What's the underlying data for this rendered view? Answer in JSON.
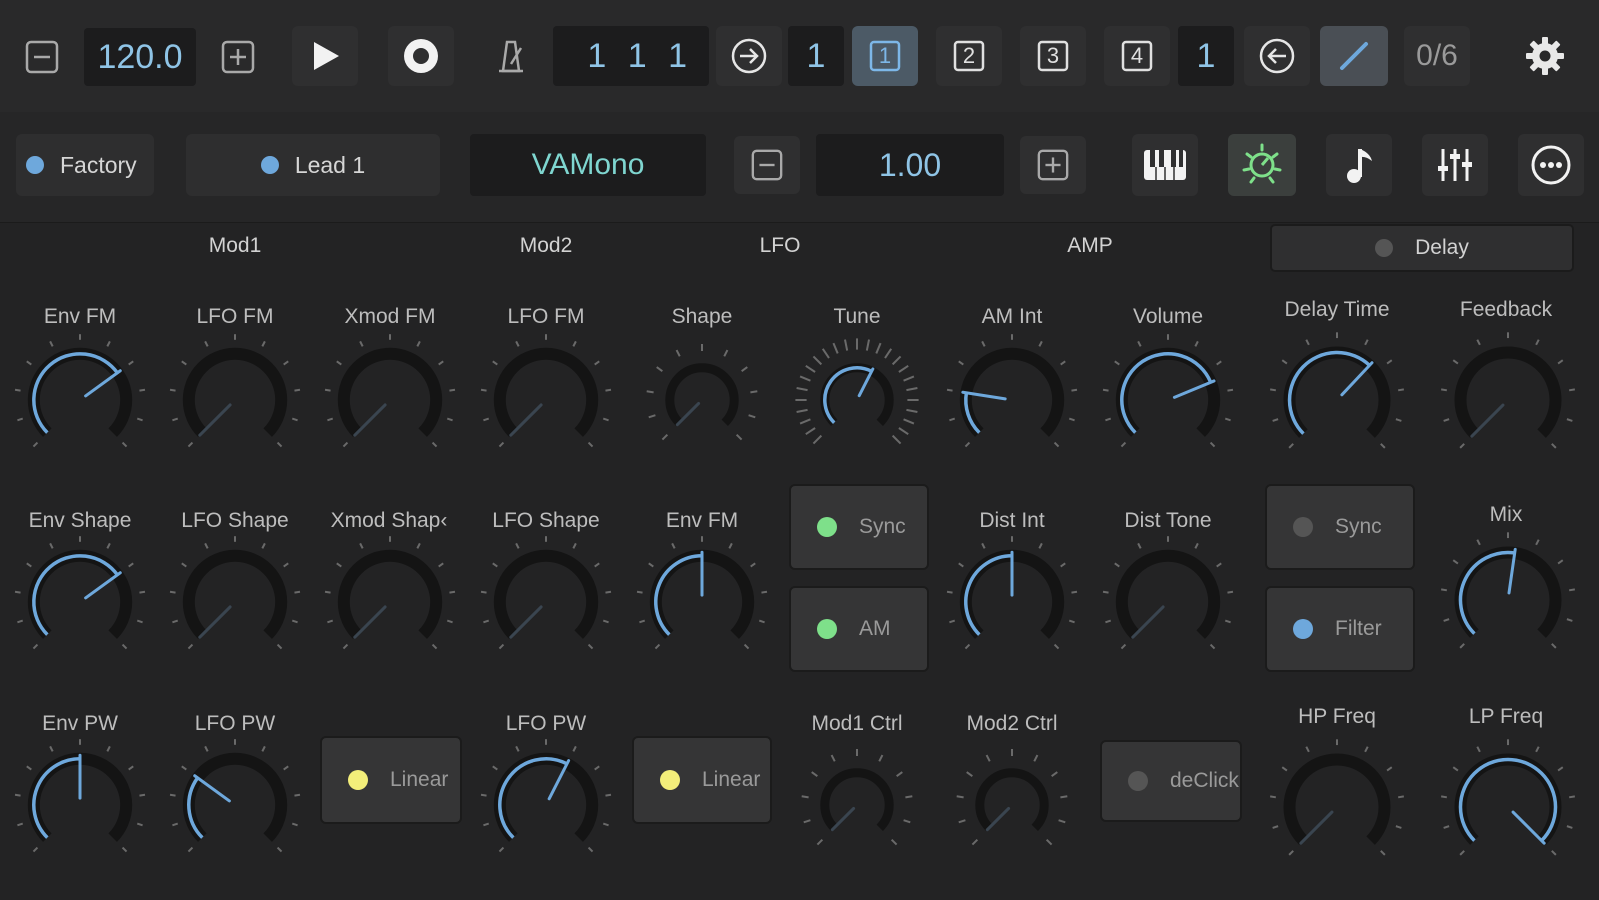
{
  "colors": {
    "accent_blue": "#6ea8dc",
    "green": "#7ee08a",
    "yellow": "#f3ee7a",
    "off": "#555555",
    "teal": "#7fd6d0"
  },
  "transport": {
    "tempo": "120.0",
    "position": "1 1 1",
    "loop_start": "1",
    "loop_end": "1",
    "scenes": [
      "1",
      "2",
      "3",
      "4"
    ],
    "counter": "0/6"
  },
  "instrument": {
    "bank_label": "Factory",
    "preset_label": "Lead 1",
    "synth_name": "VAMono",
    "param_value": "1.00"
  },
  "sections": {
    "mod1": "Mod1",
    "mod2": "Mod2",
    "lfo": "LFO",
    "amp": "AMP",
    "delay": "Delay"
  },
  "labels": {
    "env_fm_1": "Env FM",
    "lfo_fm_1": "LFO FM",
    "xmod_fm": "Xmod FM",
    "lfo_fm_2": "LFO FM",
    "shape": "Shape",
    "tune": "Tune",
    "am_int": "AM Int",
    "volume": "Volume",
    "delay_time": "Delay Time",
    "feedback": "Feedback",
    "env_shape": "Env Shape",
    "lfo_shape_1": "LFO Shape",
    "xmod_shape": "Xmod Shap‹",
    "lfo_shape_2": "LFO Shape",
    "env_fm_2": "Env FM",
    "dist_int": "Dist Int",
    "dist_tone": "Dist Tone",
    "mix": "Mix",
    "env_pw": "Env PW",
    "lfo_pw_1": "LFO PW",
    "lfo_pw_2": "LFO PW",
    "mod1_ctrl": "Mod1 Ctrl",
    "mod2_ctrl": "Mod2 Ctrl",
    "hp_freq": "HP Freq",
    "lp_freq": "LP Freq"
  },
  "toggles": {
    "sync_lfo": "Sync",
    "am": "AM",
    "linear_1": "Linear",
    "linear_2": "Linear",
    "declick": "deClick",
    "sync_delay": "Sync",
    "filter": "Filter"
  },
  "knob_values": {
    "env_fm_1": 0.7,
    "lfo_fm_1": 0.0,
    "xmod_fm": 0.0,
    "lfo_fm_2": 0.0,
    "shape": 0.0,
    "tune": 0.6,
    "am_int": 0.2,
    "volume": 0.75,
    "delay_time": 0.66,
    "feedback": 0.0,
    "env_shape": 0.7,
    "lfo_shape_1": 0.0,
    "xmod_shape": 0.0,
    "lfo_shape_2": 0.0,
    "env_fm_2": 0.5,
    "dist_int": 0.5,
    "dist_tone": 0.0,
    "mix": 0.53,
    "env_pw": 0.5,
    "lfo_pw_1": 0.3,
    "lfo_pw_2": 0.6,
    "mod1_ctrl": 0.0,
    "mod2_ctrl": 0.0,
    "hp_freq": 0.0,
    "lp_freq": 1.0
  }
}
